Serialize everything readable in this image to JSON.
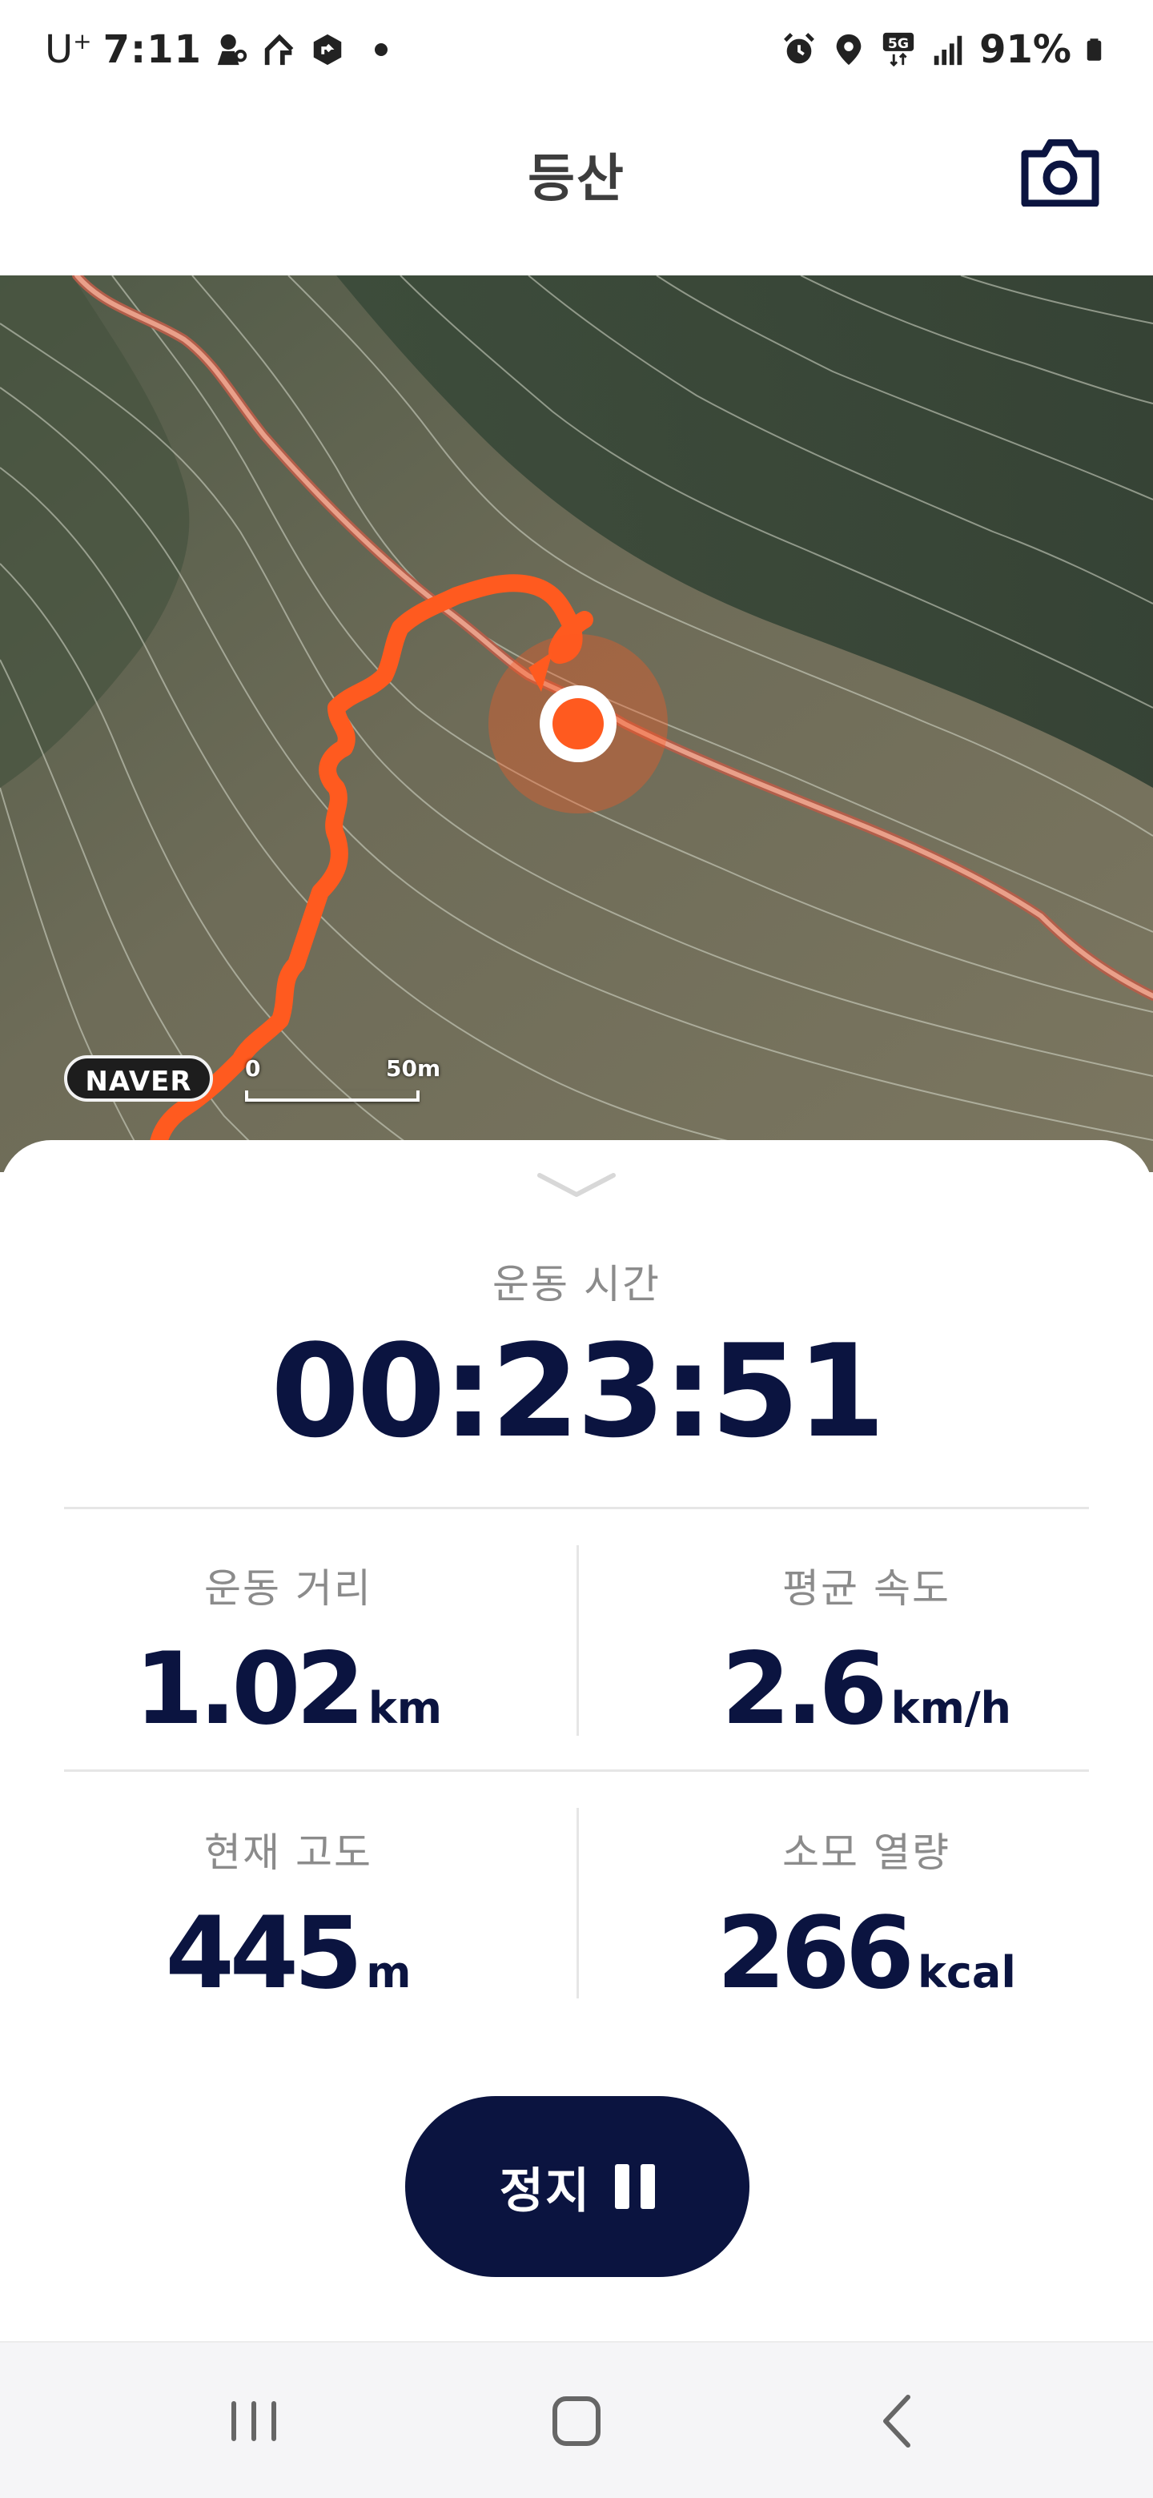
{
  "status_bar": {
    "carrier": "U",
    "carrier_plus": "+",
    "time": "7:11",
    "network": "5G",
    "battery": "91%",
    "icons": [
      "location-person-icon",
      "route-icon",
      "navigation-shield-icon",
      "dot-icon",
      "alarm-icon",
      "location-pin-icon",
      "5g-icon",
      "signal-icon",
      "battery-icon"
    ]
  },
  "header": {
    "title": "등산",
    "camera_icon": "camera-icon"
  },
  "map": {
    "provider_badge": "NAVER",
    "scale_start": "0",
    "scale_distance": "50m",
    "track_color": "#ff5a1f",
    "trail_color": "#e9a08a"
  },
  "workout": {
    "time_label": "운동 시간",
    "time_value": "00:23:51",
    "stats": [
      {
        "label": "운동 거리",
        "value": "1.02",
        "unit": "km"
      },
      {
        "label": "평균 속도",
        "value": "2.6",
        "unit": "km/h"
      },
      {
        "label": "현재 고도",
        "value": "445",
        "unit": "m"
      },
      {
        "label": "소모 열량",
        "value": "266",
        "unit": "kcal"
      }
    ],
    "stop_button_label": "정지",
    "accent_color": "#0b1440"
  },
  "nav": {
    "recent_icon": "recent-apps-icon",
    "home_icon": "home-icon",
    "back_icon": "back-icon"
  }
}
